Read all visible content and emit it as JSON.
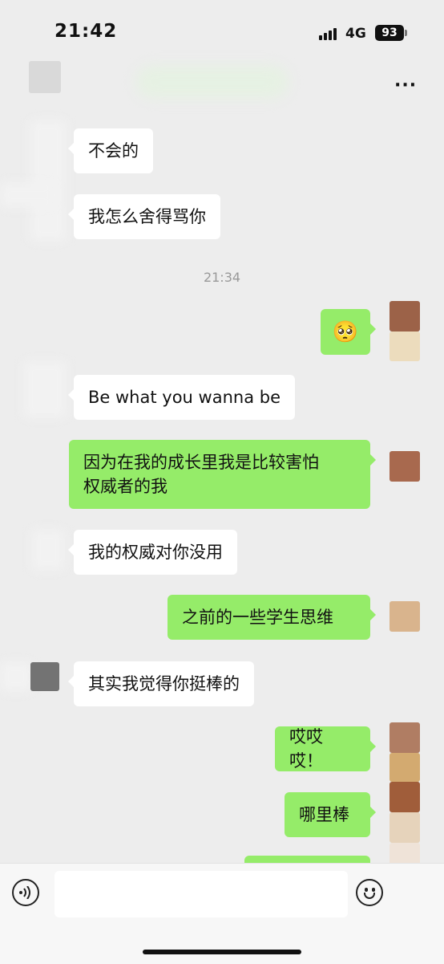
{
  "status_bar": {
    "time": "21:42",
    "network": "4G",
    "battery": "93"
  },
  "nav": {
    "more_icon": "···"
  },
  "timestamp": "21:34",
  "messages": [
    {
      "side": "left",
      "text": "不会的"
    },
    {
      "side": "left",
      "text": "我怎么舍得骂你"
    },
    {
      "side": "right",
      "text": "🥺",
      "type": "emoji-sticker"
    },
    {
      "side": "left",
      "text": "Be what you wanna be"
    },
    {
      "side": "right",
      "line1": "因为在我的成长里我是比较害怕",
      "line2": "权威者的我"
    },
    {
      "side": "left",
      "text": "我的权威对你没用"
    },
    {
      "side": "right",
      "text": "之前的一些学生思维"
    },
    {
      "side": "left",
      "text": "其实我觉得你挺棒的"
    },
    {
      "side": "right",
      "text": "哎哎哎！"
    },
    {
      "side": "right",
      "text": "哪里棒"
    }
  ],
  "input_bar": {
    "placeholder": "",
    "voice_icon": "voice-icon",
    "emoji_icon": "emoji-icon"
  },
  "colors": {
    "background": "#ededed",
    "bubble_self": "#95ec69",
    "bubble_other": "#ffffff"
  }
}
